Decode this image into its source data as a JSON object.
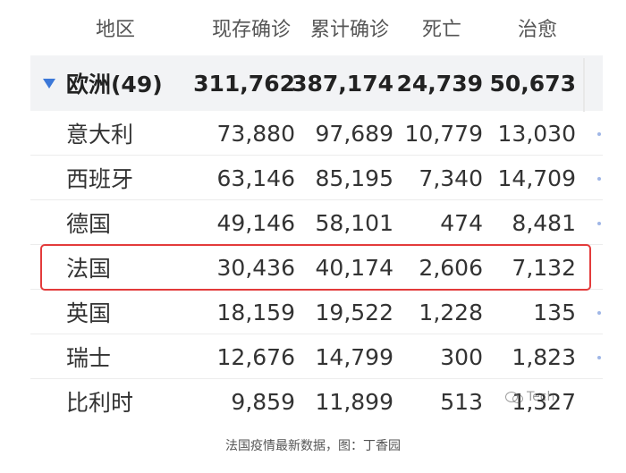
{
  "header": [
    "地区",
    "现存确诊",
    "累计确诊",
    "死亡",
    "治愈"
  ],
  "region": {
    "name": "欧洲(49)",
    "values": [
      "311,762",
      "387,174",
      "24,739",
      "50,673"
    ]
  },
  "rows": [
    {
      "name": "意大利",
      "values": [
        "73,880",
        "97,689",
        "10,779",
        "13,030"
      ]
    },
    {
      "name": "西班牙",
      "values": [
        "63,146",
        "85,195",
        "7,340",
        "14,709"
      ]
    },
    {
      "name": "德国",
      "values": [
        "49,146",
        "58,101",
        "474",
        "8,481"
      ]
    },
    {
      "name": "法国",
      "values": [
        "30,436",
        "40,174",
        "2,606",
        "7,132"
      ]
    },
    {
      "name": "英国",
      "values": [
        "18,159",
        "19,522",
        "1,228",
        "135"
      ]
    },
    {
      "name": "瑞士",
      "values": [
        "12,676",
        "14,799",
        "300",
        "1,823"
      ]
    },
    {
      "name": "比利时",
      "values": [
        "9,859",
        "11,899",
        "513",
        "1,327"
      ]
    }
  ],
  "caption": "法国疫情最新数据，图：丁香园",
  "watermark": "Tech",
  "colors": {
    "highlight": "#e33b3b",
    "accent": "#3c78d8",
    "region_bg": "#f2f3f5"
  }
}
